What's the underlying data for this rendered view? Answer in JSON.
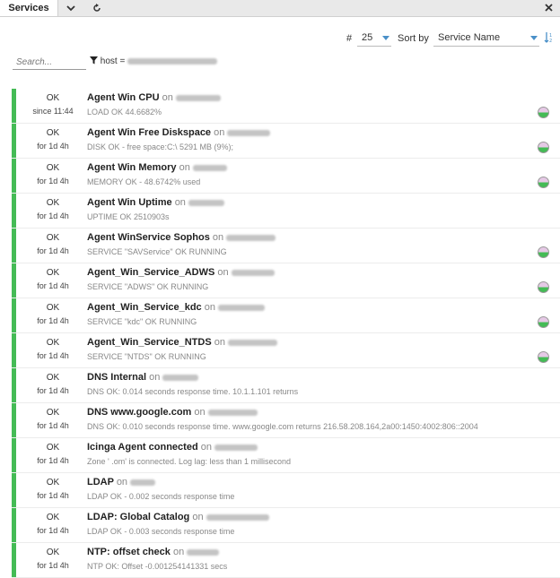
{
  "tabbar": {
    "tab_label": "Services"
  },
  "controls": {
    "limit_label": "#",
    "limit_value": "25",
    "sort_label": "Sort by",
    "sort_value": "Service Name"
  },
  "search": {
    "placeholder": "Search..."
  },
  "filter": {
    "text": "host ="
  },
  "services": [
    {
      "state": "OK",
      "since": "since 11:44",
      "name": "Agent Win CPU",
      "on": "on",
      "output": "LOAD OK 44.6682%",
      "pie": true
    },
    {
      "state": "OK",
      "since": "for 1d 4h",
      "name": "Agent Win Free Diskspace",
      "on": "on",
      "output": "DISK OK - free space:C:\\ 5291 MB (9%);",
      "pie": true
    },
    {
      "state": "OK",
      "since": "for 1d 4h",
      "name": "Agent Win Memory",
      "on": "on",
      "output": "MEMORY OK - 48.6742% used",
      "pie": true
    },
    {
      "state": "OK",
      "since": "for 1d 4h",
      "name": "Agent Win Uptime",
      "on": "on",
      "output": "UPTIME OK 2510903s",
      "pie": false
    },
    {
      "state": "OK",
      "since": "for 1d 4h",
      "name": "Agent WinService Sophos",
      "on": "on",
      "output": "SERVICE \"SAVService\" OK RUNNING",
      "pie": true
    },
    {
      "state": "OK",
      "since": "for 1d 4h",
      "name": "Agent_Win_Service_ADWS",
      "on": "on",
      "output": "SERVICE \"ADWS\" OK RUNNING",
      "pie": true
    },
    {
      "state": "OK",
      "since": "for 1d 4h",
      "name": "Agent_Win_Service_kdc",
      "on": "on",
      "output": "SERVICE \"kdc\" OK RUNNING",
      "pie": true
    },
    {
      "state": "OK",
      "since": "for 1d 4h",
      "name": "Agent_Win_Service_NTDS",
      "on": "on",
      "output": "SERVICE \"NTDS\" OK RUNNING",
      "pie": true
    },
    {
      "state": "OK",
      "since": "for 1d 4h",
      "name": "DNS Internal",
      "on": "on",
      "output": "DNS OK: 0.014 seconds response time. 10.1.1.101 returns",
      "pie": false
    },
    {
      "state": "OK",
      "since": "for 1d 4h",
      "name": "DNS www.google.com",
      "on": "on",
      "output": "DNS OK: 0.010 seconds response time. www.google.com returns 216.58.208.164,2a00:1450:4002:806::2004",
      "pie": false
    },
    {
      "state": "OK",
      "since": "for 1d 4h",
      "name": "Icinga Agent connected",
      "on": "on",
      "output": "Zone '                              .om' is connected. Log lag: less than 1 millisecond",
      "pie": false
    },
    {
      "state": "OK",
      "since": "for 1d 4h",
      "name": "LDAP",
      "on": "on",
      "output": "LDAP OK - 0.002 seconds response time",
      "pie": false
    },
    {
      "state": "OK",
      "since": "for 1d 4h",
      "name": "LDAP: Global Catalog",
      "on": "on",
      "output": "LDAP OK - 0.003 seconds response time",
      "pie": false
    },
    {
      "state": "OK",
      "since": "for 1d 4h",
      "name": "NTP: offset check",
      "on": "on",
      "output": "NTP OK: Offset -0.001254141331 secs",
      "pie": false
    }
  ]
}
